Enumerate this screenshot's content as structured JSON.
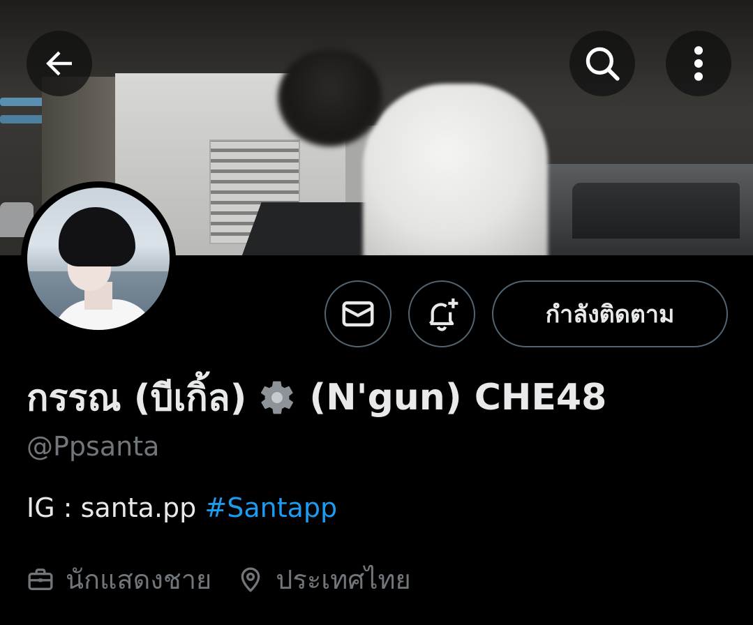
{
  "header": {
    "back_icon": "arrow-left-icon",
    "search_icon": "search-icon",
    "more_icon": "more-vertical-icon"
  },
  "profile": {
    "display_name_before": "กรรณ (บีเกิ้ล)",
    "display_name_emoji": "gear-icon",
    "display_name_after": "(N'gun) CHE48",
    "handle": "@Ppsanta",
    "bio_text": "IG : santa.pp ",
    "bio_hashtag": "#Santapp",
    "profession": "นักแสดงชาย",
    "profession_icon": "briefcase-icon",
    "location": "ประเทศไทย",
    "location_icon": "location-pin-icon"
  },
  "actions": {
    "message_icon": "envelope-icon",
    "notify_icon": "bell-plus-icon",
    "follow_label": "กำลังติดตาม"
  },
  "colors": {
    "background": "#000000",
    "text_primary": "#e7e9ea",
    "text_secondary": "#71767b",
    "link": "#1d9bf0",
    "border": "#536471"
  }
}
